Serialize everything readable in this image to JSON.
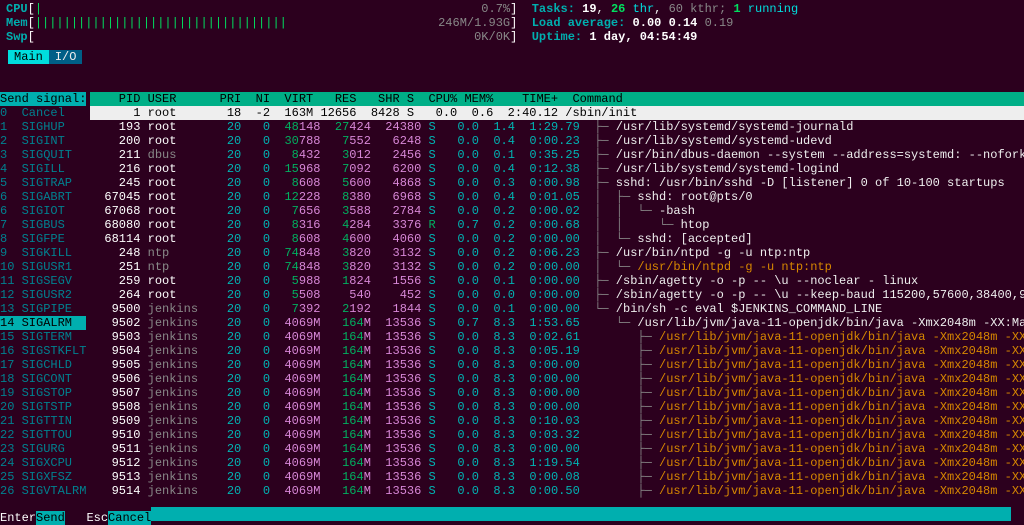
{
  "meters": {
    "cpu": {
      "label": "CPU",
      "bar": "|",
      "value": "0.7%"
    },
    "mem": {
      "label": "Mem",
      "bar": "|||||||||||||||||||||||||||||||||||",
      "value": "246M/1.93G"
    },
    "swp": {
      "label": "Swp",
      "bar": "",
      "value": "0K/0K"
    },
    "tasksLabel": "Tasks:",
    "tasksProcs": "19",
    "tasksThr": "26",
    "tasksThrSuffix": "thr",
    "kthr": "60 kthr;",
    "running": "1",
    "runningSuffix": "running",
    "loadLabel": "Load average:",
    "load1": "0.00",
    "load2": "0.14",
    "load3": "0.19",
    "uptimeLabel": "Uptime:",
    "uptime": "1 day, 04:54:49"
  },
  "tabs": {
    "main": "Main",
    "io": "I/O"
  },
  "signalPanel": {
    "title": "Send signal:",
    "items": [
      "0  Cancel",
      "1  SIGHUP",
      "2  SIGINT",
      "3  SIGQUIT",
      "4  SIGILL",
      "5  SIGTRAP",
      "6  SIGABRT",
      "6  SIGIOT",
      "7  SIGBUS",
      "8  SIGFPE",
      "9  SIGKILL",
      "10 SIGUSR1",
      "11 SIGSEGV",
      "12 SIGUSR2",
      "13 SIGPIPE",
      "14 SIGALRM",
      "15 SIGTERM",
      "16 SIGSTKFLT",
      "17 SIGCHLD",
      "18 SIGCONT",
      "19 SIGSTOP",
      "20 SIGTSTP",
      "21 SIGTTIN",
      "22 SIGTTOU",
      "23 SIGURG",
      "24 SIGXCPU",
      "25 SIGXFSZ",
      "26 SIGVTALRM"
    ],
    "selectedIndex": 15
  },
  "columns": {
    "pid": "PID",
    "user": "USER",
    "pri": "PRI",
    "ni": "NI",
    "virt": "VIRT",
    "res": "RES",
    "shr": "SHR",
    "s": "S",
    "cpu": "CPU%",
    "mem": "MEM%",
    "time": "TIME+",
    "command": "Command"
  },
  "processes": [
    {
      "pid": "1",
      "user": "root",
      "pri": "18",
      "ni": "-2",
      "virt": "163M",
      "res": "12656",
      "shr": "8428",
      "s": "S",
      "cpu": "0.0",
      "mem": "0.6",
      "time": "2:40.12",
      "cmd": "/sbin/init",
      "sel": true,
      "tree": ""
    },
    {
      "pid": "193",
      "user": "root",
      "pri": "20",
      "ni": "0",
      "virt": "48148",
      "res": "27424",
      "shr": "24380",
      "s": "S",
      "cpu": "0.0",
      "mem": "1.4",
      "time": "1:29.79",
      "cmd": "/usr/lib/systemd/systemd-journald",
      "tree": "├─ "
    },
    {
      "pid": "200",
      "user": "root",
      "pri": "20",
      "ni": "0",
      "virt": "30788",
      "res": "7552",
      "shr": "6248",
      "s": "S",
      "cpu": "0.0",
      "mem": "0.4",
      "time": "0:00.23",
      "cmd": "/usr/lib/systemd/systemd-udevd",
      "tree": "├─ "
    },
    {
      "pid": "211",
      "user": "dbus",
      "pri": "20",
      "ni": "0",
      "virt": "8432",
      "res": "3012",
      "shr": "2456",
      "s": "S",
      "cpu": "0.0",
      "mem": "0.1",
      "time": "0:35.25",
      "cmd": "/usr/bin/dbus-daemon --system --address=systemd: --nofork",
      "tree": "├─ "
    },
    {
      "pid": "216",
      "user": "root",
      "pri": "20",
      "ni": "0",
      "virt": "15968",
      "res": "7092",
      "shr": "6200",
      "s": "S",
      "cpu": "0.0",
      "mem": "0.4",
      "time": "0:12.38",
      "cmd": "/usr/lib/systemd/systemd-logind",
      "tree": "├─ "
    },
    {
      "pid": "245",
      "user": "root",
      "pri": "20",
      "ni": "0",
      "virt": "8608",
      "res": "5600",
      "shr": "4868",
      "s": "S",
      "cpu": "0.0",
      "mem": "0.3",
      "time": "0:00.98",
      "cmd": "sshd: /usr/bin/sshd -D [listener] 0 of 10-100 startups",
      "tree": "├─ "
    },
    {
      "pid": "67045",
      "user": "root",
      "pri": "20",
      "ni": "0",
      "virt": "12228",
      "res": "8380",
      "shr": "6968",
      "s": "S",
      "cpu": "0.0",
      "mem": "0.4",
      "time": "0:01.05",
      "cmd": "sshd: root@pts/0",
      "tree": "│  ├─ "
    },
    {
      "pid": "67068",
      "user": "root",
      "pri": "20",
      "ni": "0",
      "virt": "7656",
      "res": "3588",
      "shr": "2784",
      "s": "S",
      "cpu": "0.0",
      "mem": "0.2",
      "time": "0:00.02",
      "cmd": "-bash",
      "tree": "│  │  └─ "
    },
    {
      "pid": "68080",
      "user": "root",
      "pri": "20",
      "ni": "0",
      "virt": "8316",
      "res": "4284",
      "shr": "3376",
      "s": "R",
      "cpu": "0.7",
      "mem": "0.2",
      "time": "0:00.68",
      "cmd": "htop",
      "tree": "│  │     └─ ",
      "srun": true
    },
    {
      "pid": "68114",
      "user": "root",
      "pri": "20",
      "ni": "0",
      "virt": "8608",
      "res": "4600",
      "shr": "4060",
      "s": "S",
      "cpu": "0.0",
      "mem": "0.2",
      "time": "0:00.00",
      "cmd": "sshd: [accepted]",
      "tree": "│  └─ "
    },
    {
      "pid": "248",
      "user": "ntp",
      "pri": "20",
      "ni": "0",
      "virt": "74848",
      "res": "3820",
      "shr": "3132",
      "s": "S",
      "cpu": "0.0",
      "mem": "0.2",
      "time": "0:06.23",
      "cmd": "/usr/bin/ntpd -g -u ntp:ntp",
      "tree": "├─ "
    },
    {
      "pid": "251",
      "user": "ntp",
      "pri": "20",
      "ni": "0",
      "virt": "74848",
      "res": "3820",
      "shr": "3132",
      "s": "S",
      "cpu": "0.0",
      "mem": "0.2",
      "time": "0:00.00",
      "cmd": "/usr/bin/ntpd -g -u ntp:ntp",
      "tree": "│  └─ ",
      "dim": true
    },
    {
      "pid": "259",
      "user": "root",
      "pri": "20",
      "ni": "0",
      "virt": "5988",
      "res": "1824",
      "shr": "1556",
      "s": "S",
      "cpu": "0.0",
      "mem": "0.1",
      "time": "0:00.00",
      "cmd": "/sbin/agetty -o -p -- \\u --noclear - linux",
      "tree": "├─ "
    },
    {
      "pid": "264",
      "user": "root",
      "pri": "20",
      "ni": "0",
      "virt": "5508",
      "res": "540",
      "shr": "452",
      "s": "S",
      "cpu": "0.0",
      "mem": "0.0",
      "time": "0:00.00",
      "cmd": "/sbin/agetty -o -p -- \\u --keep-baud 115200,57600,38400,9",
      "tree": "├─ "
    },
    {
      "pid": "9500",
      "user": "jenkins",
      "pri": "20",
      "ni": "0",
      "virt": "7392",
      "res": "2192",
      "shr": "1844",
      "s": "S",
      "cpu": "0.0",
      "mem": "0.1",
      "time": "0:00.00",
      "cmd": "/bin/sh -c eval $JENKINS_COMMAND_LINE",
      "tree": "└─ "
    },
    {
      "pid": "9502",
      "user": "jenkins",
      "pri": "20",
      "ni": "0",
      "virt": "4069M",
      "res": "164M",
      "shr": "13536",
      "s": "S",
      "cpu": "0.7",
      "mem": "8.3",
      "time": "1:53.65",
      "cmd": "/usr/lib/jvm/java-11-openjdk/bin/java -Xmx2048m -XX:Ma",
      "tree": "   └─ "
    },
    {
      "pid": "9503",
      "user": "jenkins",
      "pri": "20",
      "ni": "0",
      "virt": "4069M",
      "res": "164M",
      "shr": "13536",
      "s": "S",
      "cpu": "0.0",
      "mem": "8.3",
      "time": "0:02.61",
      "cmd": "/usr/lib/jvm/java-11-openjdk/bin/java -Xmx2048m -XX",
      "tree": "      ├─ ",
      "dim": true
    },
    {
      "pid": "9504",
      "user": "jenkins",
      "pri": "20",
      "ni": "0",
      "virt": "4069M",
      "res": "164M",
      "shr": "13536",
      "s": "S",
      "cpu": "0.0",
      "mem": "8.3",
      "time": "0:05.19",
      "cmd": "/usr/lib/jvm/java-11-openjdk/bin/java -Xmx2048m -XX",
      "tree": "      ├─ ",
      "dim": true
    },
    {
      "pid": "9505",
      "user": "jenkins",
      "pri": "20",
      "ni": "0",
      "virt": "4069M",
      "res": "164M",
      "shr": "13536",
      "s": "S",
      "cpu": "0.0",
      "mem": "8.3",
      "time": "0:00.00",
      "cmd": "/usr/lib/jvm/java-11-openjdk/bin/java -Xmx2048m -XX",
      "tree": "      ├─ ",
      "dim": true
    },
    {
      "pid": "9506",
      "user": "jenkins",
      "pri": "20",
      "ni": "0",
      "virt": "4069M",
      "res": "164M",
      "shr": "13536",
      "s": "S",
      "cpu": "0.0",
      "mem": "8.3",
      "time": "0:00.00",
      "cmd": "/usr/lib/jvm/java-11-openjdk/bin/java -Xmx2048m -XX",
      "tree": "      ├─ ",
      "dim": true
    },
    {
      "pid": "9507",
      "user": "jenkins",
      "pri": "20",
      "ni": "0",
      "virt": "4069M",
      "res": "164M",
      "shr": "13536",
      "s": "S",
      "cpu": "0.0",
      "mem": "8.3",
      "time": "0:00.00",
      "cmd": "/usr/lib/jvm/java-11-openjdk/bin/java -Xmx2048m -XX",
      "tree": "      ├─ ",
      "dim": true
    },
    {
      "pid": "9508",
      "user": "jenkins",
      "pri": "20",
      "ni": "0",
      "virt": "4069M",
      "res": "164M",
      "shr": "13536",
      "s": "S",
      "cpu": "0.0",
      "mem": "8.3",
      "time": "0:00.00",
      "cmd": "/usr/lib/jvm/java-11-openjdk/bin/java -Xmx2048m -XX",
      "tree": "      ├─ ",
      "dim": true
    },
    {
      "pid": "9509",
      "user": "jenkins",
      "pri": "20",
      "ni": "0",
      "virt": "4069M",
      "res": "164M",
      "shr": "13536",
      "s": "S",
      "cpu": "0.0",
      "mem": "8.3",
      "time": "0:10.03",
      "cmd": "/usr/lib/jvm/java-11-openjdk/bin/java -Xmx2048m -XX",
      "tree": "      ├─ ",
      "dim": true
    },
    {
      "pid": "9510",
      "user": "jenkins",
      "pri": "20",
      "ni": "0",
      "virt": "4069M",
      "res": "164M",
      "shr": "13536",
      "s": "S",
      "cpu": "0.0",
      "mem": "8.3",
      "time": "0:03.32",
      "cmd": "/usr/lib/jvm/java-11-openjdk/bin/java -Xmx2048m -XX",
      "tree": "      ├─ ",
      "dim": true
    },
    {
      "pid": "9511",
      "user": "jenkins",
      "pri": "20",
      "ni": "0",
      "virt": "4069M",
      "res": "164M",
      "shr": "13536",
      "s": "S",
      "cpu": "0.0",
      "mem": "8.3",
      "time": "0:00.00",
      "cmd": "/usr/lib/jvm/java-11-openjdk/bin/java -Xmx2048m -XX",
      "tree": "      ├─ ",
      "dim": true
    },
    {
      "pid": "9512",
      "user": "jenkins",
      "pri": "20",
      "ni": "0",
      "virt": "4069M",
      "res": "164M",
      "shr": "13536",
      "s": "S",
      "cpu": "0.0",
      "mem": "8.3",
      "time": "1:19.54",
      "cmd": "/usr/lib/jvm/java-11-openjdk/bin/java -Xmx2048m -XX",
      "tree": "      ├─ ",
      "dim": true
    },
    {
      "pid": "9513",
      "user": "jenkins",
      "pri": "20",
      "ni": "0",
      "virt": "4069M",
      "res": "164M",
      "shr": "13536",
      "s": "S",
      "cpu": "0.0",
      "mem": "8.3",
      "time": "0:00.08",
      "cmd": "/usr/lib/jvm/java-11-openjdk/bin/java -Xmx2048m -XX",
      "tree": "      ├─ ",
      "dim": true
    },
    {
      "pid": "9514",
      "user": "jenkins",
      "pri": "20",
      "ni": "0",
      "virt": "4069M",
      "res": "164M",
      "shr": "13536",
      "s": "S",
      "cpu": "0.0",
      "mem": "8.3",
      "time": "0:00.50",
      "cmd": "/usr/lib/jvm/java-11-openjdk/bin/java -Xmx2048m -XX",
      "tree": "      ├─ ",
      "dim": true
    }
  ],
  "bottombar": {
    "enter": "Enter",
    "send": "Send",
    "esc": "Esc",
    "cancel": "Cancel"
  }
}
